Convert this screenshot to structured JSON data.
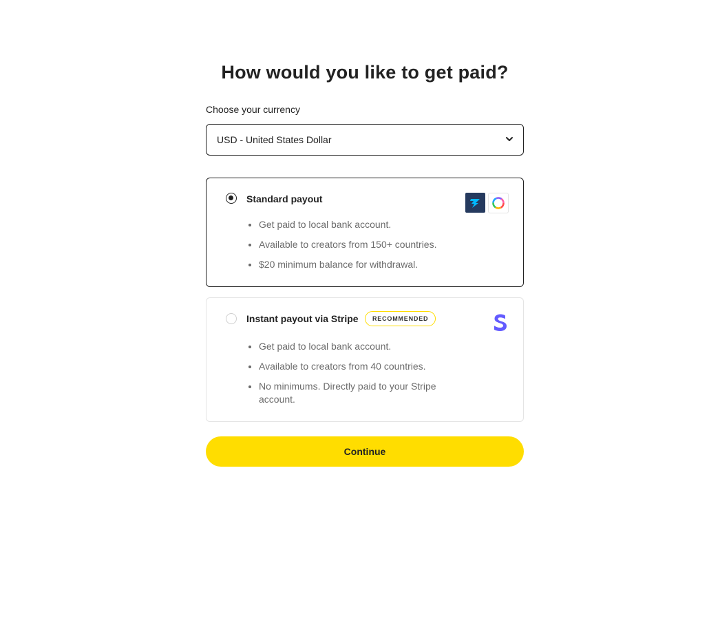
{
  "page": {
    "title": "How would you like to get paid?"
  },
  "currency": {
    "label": "Choose your currency",
    "selected": "USD - United States Dollar",
    "chevron_icon": "chevron-down-icon"
  },
  "options": [
    {
      "title": "Standard payout",
      "selected": true,
      "bullets": [
        "Get paid to local bank account.",
        "Available to creators from 150+ countries.",
        "$20 minimum balance for withdrawal."
      ],
      "logos": [
        "wise-logo",
        "payoneer-ring-logo"
      ]
    },
    {
      "title": "Instant payout via Stripe",
      "badge": "RECOMMENDED",
      "selected": false,
      "bullets": [
        "Get paid to local bank account.",
        "Available to creators from 40 countries.",
        "No minimums. Directly paid to your Stripe account."
      ],
      "logos": [
        "stripe-logo"
      ]
    }
  ],
  "actions": {
    "continue_label": "Continue"
  },
  "colors": {
    "accent": "#ffdd00",
    "text": "#222222",
    "muted": "#6b6b6b",
    "stripe": "#635bff",
    "wise": "#253a5e",
    "wise_flag": "#00b9ff"
  }
}
